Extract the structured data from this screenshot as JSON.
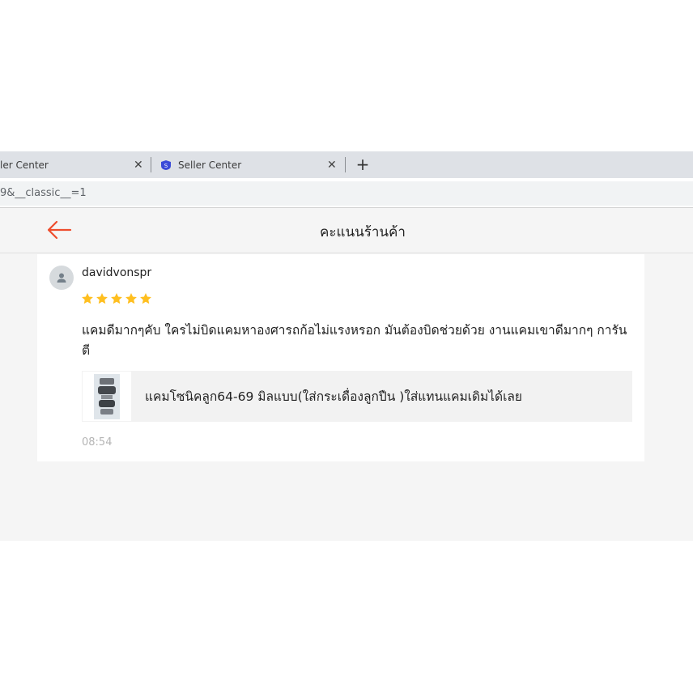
{
  "browser": {
    "tabs": [
      {
        "title": "ler Center",
        "close": "✕"
      },
      {
        "title": "Seller Center",
        "close": "✕"
      }
    ],
    "new_tab": "+",
    "url": "9&__classic__=1"
  },
  "page": {
    "title": "คะแนนร้านค้า"
  },
  "review": {
    "username": "davidvonspr",
    "rating": 5,
    "star_color": "#ffbf1f",
    "comment": "แคมดีมากๆคับ ใครไม่บิดแคมหาองศารถก้อไม่แรงหรอก มันต้องบิดช่วยด้วย งานแคมเขาดีมากๆ การันตี",
    "product_name": "แคมโซนิคลูก64-69 มิลแบบ(ใส่กระเดื่องลูกปืน )ใส่แทนแคมเดิมได้เลย",
    "time": "08:54"
  },
  "colors": {
    "accent": "#ee4d2d",
    "page_bg": "#f5f5f5"
  }
}
